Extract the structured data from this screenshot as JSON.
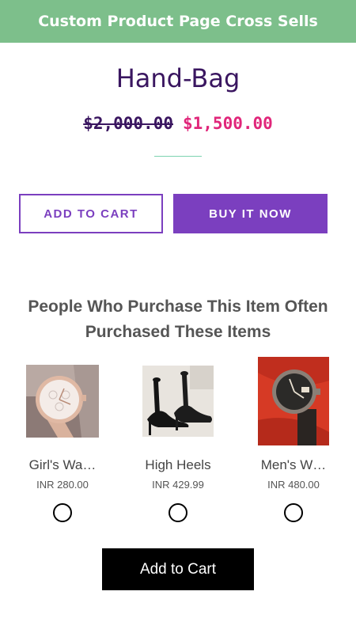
{
  "banner": {
    "title": "Custom Product Page Cross Sells"
  },
  "product": {
    "name": "Hand-Bag",
    "price_original": "$2,000.00",
    "price_sale": "$1,500.00"
  },
  "actions": {
    "add_to_cart": "ADD TO CART",
    "buy_now": "BUY IT NOW"
  },
  "colors": {
    "banner": "#7dbf8b",
    "accent_purple": "#7b3fbf",
    "title_dark": "#3a1660",
    "sale_pink": "#e0267a"
  },
  "cross_sell": {
    "heading": "People Who Purchase This Item Often Purchased These Items",
    "items": [
      {
        "name": "Girl's Wa…",
        "price": "INR 280.00",
        "image": "womens-rose-gold-watch",
        "selected": false
      },
      {
        "name": "High Heels",
        "price": "INR 429.99",
        "image": "black-high-heels",
        "selected": false
      },
      {
        "name": "Men's W…",
        "price": "INR 480.00",
        "image": "mens-watch-on-red",
        "selected": false
      }
    ],
    "add_to_cart": "Add to Cart"
  }
}
